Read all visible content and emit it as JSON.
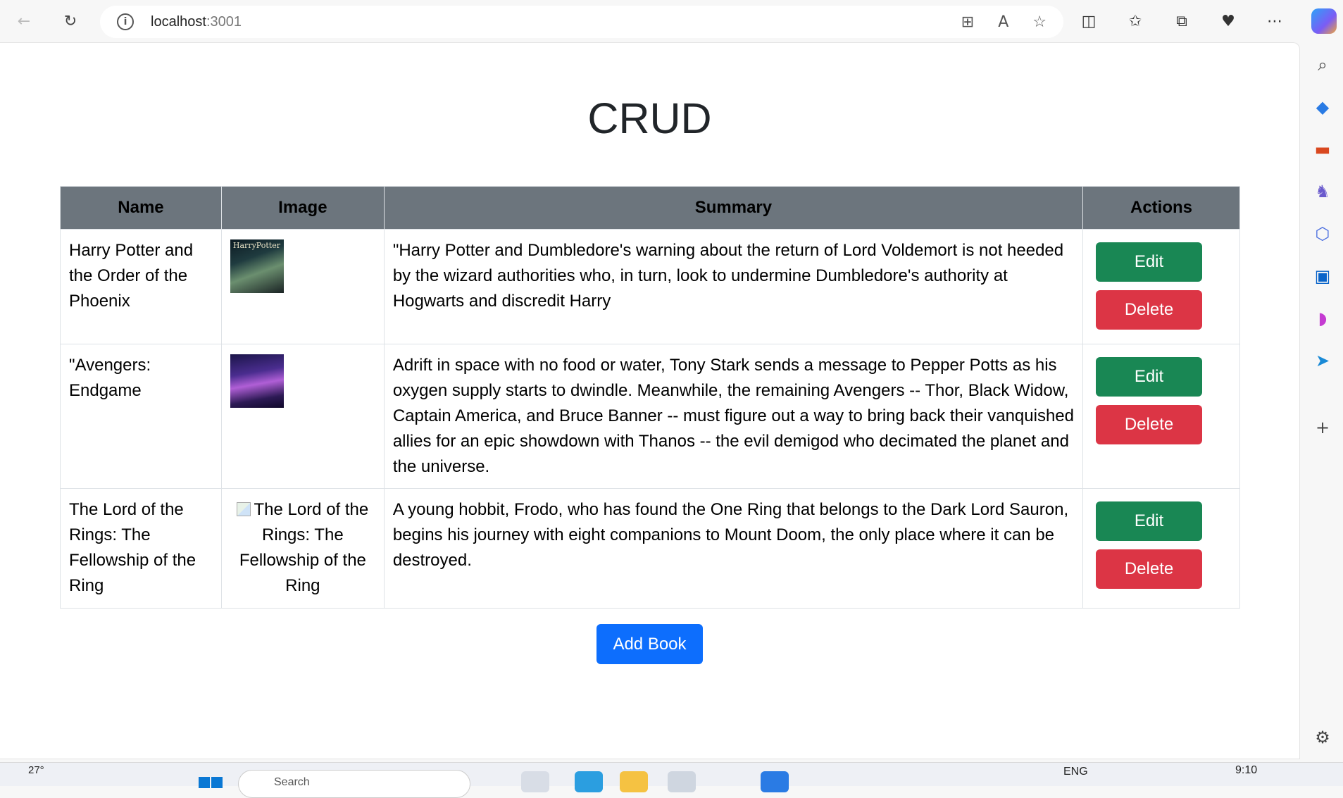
{
  "browser": {
    "url_host": "localhost",
    "url_port": ":3001"
  },
  "page": {
    "title": "CRUD",
    "table": {
      "headers": [
        "Name",
        "Image",
        "Summary",
        "Actions"
      ],
      "rows": [
        {
          "name": "Harry Potter and the Order of the Phoenix",
          "image": "hp-cover",
          "summary": "\"Harry Potter and Dumbledore's warning about the return of Lord Voldemort is not heeded by the wizard authorities who, in turn, look to undermine Dumbledore's authority at Hogwarts and discredit Harry",
          "edit_label": "Edit",
          "delete_label": "Delete"
        },
        {
          "name": "\"Avengers: Endgame",
          "image": "avengers-cover",
          "summary": "Adrift in space with no food or water, Tony Stark sends a message to Pepper Potts as his oxygen supply starts to dwindle. Meanwhile, the remaining Avengers -- Thor, Black Widow, Captain America, and Bruce Banner -- must figure out a way to bring back their vanquished allies for an epic showdown with Thanos -- the evil demigod who decimated the planet and the universe.",
          "edit_label": "Edit",
          "delete_label": "Delete"
        },
        {
          "name": "The Lord of the Rings: The Fellowship of the Ring",
          "image_alt": "The Lord of the Rings: The Fellowship of the Ring",
          "summary": "A young hobbit, Frodo, who has found the One Ring that belongs to the Dark Lord Sauron, begins his journey with eight companions to Mount Doom, the only place where it can be destroyed.",
          "edit_label": "Edit",
          "delete_label": "Delete"
        }
      ]
    },
    "add_button_label": "Add Book"
  },
  "taskbar": {
    "weather": "27°",
    "search_placeholder": "Search",
    "language": "ENG",
    "time": "9:10"
  },
  "colors": {
    "header_bg": "#6c757d",
    "edit_button": "#198754",
    "delete_button": "#dc3545",
    "add_button": "#0d6efd"
  }
}
